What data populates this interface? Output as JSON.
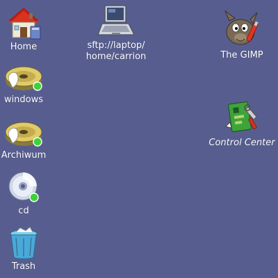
{
  "desktop": {
    "background": "#575e8f",
    "icons": [
      {
        "label": "Home",
        "icon": "home-icon"
      },
      {
        "label": "windows",
        "icon": "hard-drive-icon"
      },
      {
        "label": "Archiwum",
        "icon": "hard-drive-icon"
      },
      {
        "label": "cd",
        "icon": "cd-drive-icon"
      },
      {
        "label": "Trash",
        "icon": "trash-icon"
      },
      {
        "label": "sftp://laptop/\nhome/carrion",
        "icon": "laptop-icon"
      },
      {
        "label": "The GIMP",
        "icon": "gimp-icon"
      },
      {
        "label": "Control Center",
        "icon": "control-center-icon"
      }
    ]
  }
}
